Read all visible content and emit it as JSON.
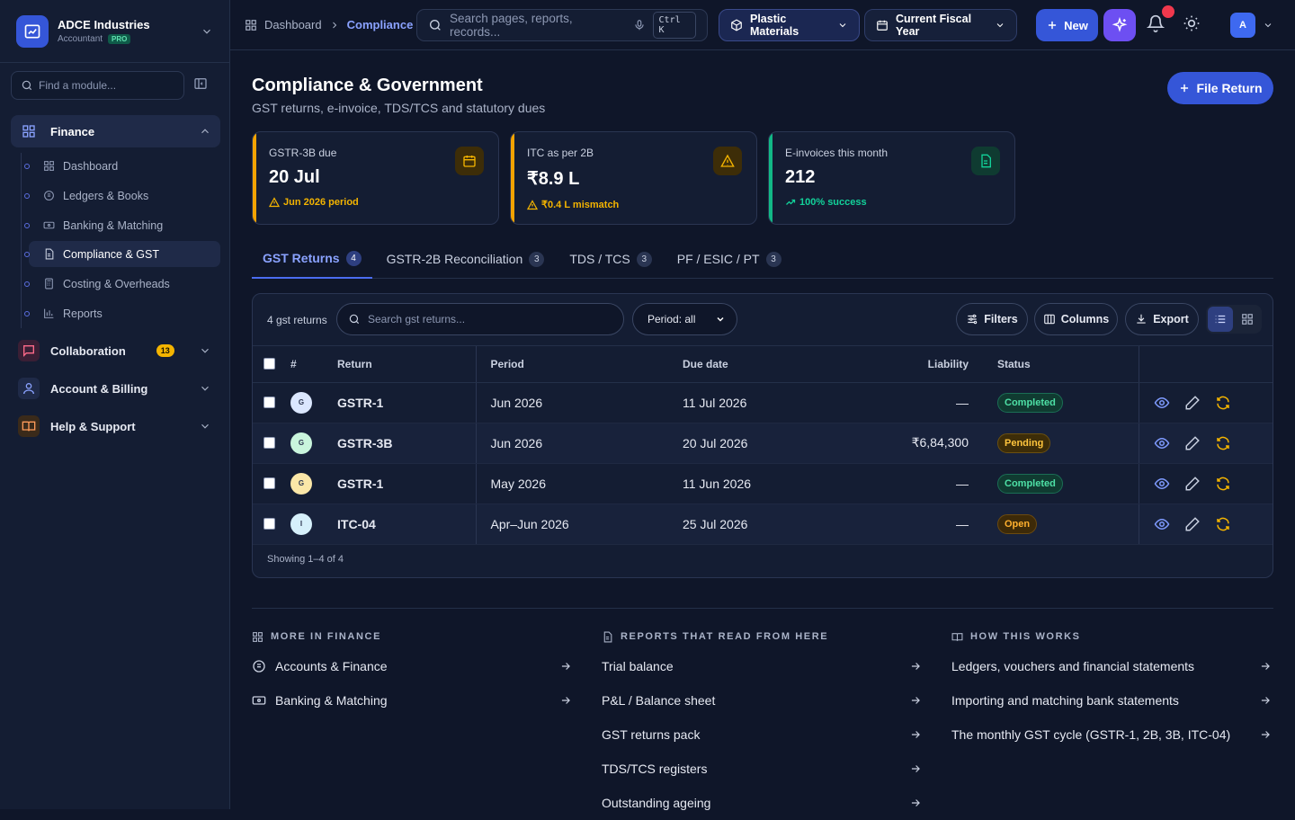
{
  "org": {
    "name": "ADCE Industries",
    "role": "Accountant",
    "plan": "PRO"
  },
  "sidebar": {
    "find_placeholder": "Find a module...",
    "groups": [
      {
        "label": "Finance",
        "icon": "grid-icon"
      },
      {
        "label": "Collaboration",
        "icon": "chat-icon",
        "badge": "13"
      },
      {
        "label": "Account & Billing",
        "icon": "user-icon"
      },
      {
        "label": "Help & Support",
        "icon": "book-icon"
      }
    ],
    "finance_items": [
      {
        "label": "Dashboard",
        "icon": "grid-icon"
      },
      {
        "label": "Ledgers & Books",
        "icon": "coin-icon"
      },
      {
        "label": "Banking & Matching",
        "icon": "bank-card-icon"
      },
      {
        "label": "Compliance & GST",
        "icon": "document-icon"
      },
      {
        "label": "Costing & Overheads",
        "icon": "calculator-icon"
      },
      {
        "label": "Reports",
        "icon": "bar-chart-icon"
      }
    ]
  },
  "topbar": {
    "breadcrumb": [
      "Dashboard",
      "Compliance"
    ],
    "search_placeholder": "Search pages, reports, records...",
    "shortcut": "Ctrl K",
    "company": "Plastic Materials",
    "period": "Current Fiscal Year",
    "new_label": "New",
    "avatar": "A"
  },
  "page": {
    "title": "Compliance & Government",
    "subtitle": "GST returns, e-invoice, TDS/TCS and statutory dues",
    "file_return": "File Return"
  },
  "kpis": [
    {
      "title": "GSTR-3B due",
      "value": "20 Jul",
      "note": "Jun 2026 period",
      "accent": "#f4a300"
    },
    {
      "title": "ITC as per 2B",
      "value": "₹8.9 L",
      "note": "₹0.4 L mismatch",
      "accent": "#f4a300"
    },
    {
      "title": "E-invoices this month",
      "value": "212",
      "note": "100% success",
      "accent": "#12b886"
    }
  ],
  "tabs": [
    {
      "label": "GST Returns",
      "count": "4"
    },
    {
      "label": "GSTR-2B Reconciliation",
      "count": "3"
    },
    {
      "label": "TDS / TCS",
      "count": "3"
    },
    {
      "label": "PF / ESIC / PT",
      "count": "3"
    }
  ],
  "table": {
    "count_label": "4 gst returns",
    "search_placeholder": "Search gst returns...",
    "period_filter": "Period: all",
    "filters": "Filters",
    "columns_btn": "Columns",
    "export": "Export",
    "headers": {
      "num": "#",
      "return": "Return",
      "period": "Period",
      "due": "Due date",
      "liability": "Liability",
      "status": "Status"
    },
    "rows": [
      {
        "initial": "G",
        "avatar_color": "#dbe7ff",
        "return": "GSTR-1",
        "period": "Jun 2026",
        "due": "11 Jul 2026",
        "liability": "—",
        "status": "Completed",
        "status_class": "completed"
      },
      {
        "initial": "G",
        "avatar_color": "#c9f5dd",
        "return": "GSTR-3B",
        "period": "Jun 2026",
        "due": "20 Jul 2026",
        "liability": "₹6,84,300",
        "status": "Pending",
        "status_class": "pending"
      },
      {
        "initial": "G",
        "avatar_color": "#fbe7a8",
        "return": "GSTR-1",
        "period": "May 2026",
        "due": "11 Jun 2026",
        "liability": "—",
        "status": "Completed",
        "status_class": "completed"
      },
      {
        "initial": "I",
        "avatar_color": "#d6f0fb",
        "return": "ITC-04",
        "period": "Apr–Jun 2026",
        "due": "25 Jul 2026",
        "liability": "—",
        "status": "Open",
        "status_class": "open"
      }
    ],
    "footer": "Showing 1–4 of 4"
  },
  "more": {
    "finance_title": "MORE IN FINANCE",
    "finance": [
      "Accounts & Finance",
      "Banking & Matching"
    ],
    "reports_title": "REPORTS THAT READ FROM HERE",
    "reports": [
      "Trial balance",
      "P&L / Balance sheet",
      "GST returns pack",
      "TDS/TCS registers",
      "Outstanding ageing"
    ],
    "how_title": "HOW THIS WORKS",
    "how": [
      "Ledgers, vouchers and financial statements",
      "Importing and matching bank statements",
      "The monthly GST cycle (GSTR-1, 2B, 3B, ITC-04)"
    ]
  }
}
